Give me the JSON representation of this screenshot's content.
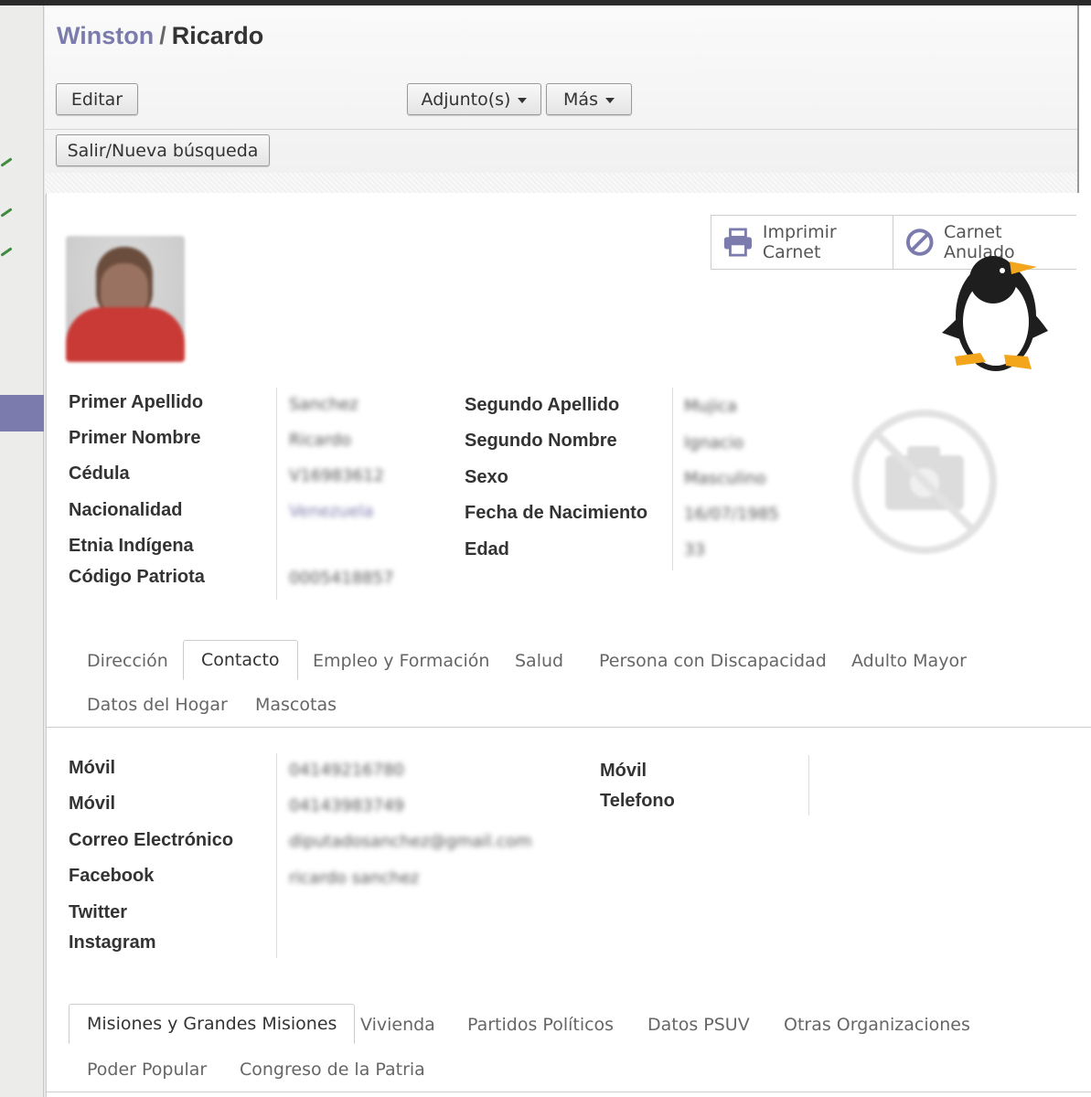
{
  "breadcrumb": {
    "parent": "Winston",
    "separator": "/",
    "current": "Ricardo"
  },
  "toolbar": {
    "edit_label": "Editar",
    "attachments_label": "Adjunto(s)",
    "more_label": "Más",
    "exit_search_label": "Salir/Nueva búsqueda"
  },
  "smart_buttons": {
    "print_label": "Imprimir Carnet",
    "cancelled_label": "Carnet Anulado"
  },
  "personal": {
    "left_labels": [
      "Primer Apellido",
      "Primer Nombre",
      "Cédula",
      "Nacionalidad",
      "Etnia Indígena",
      "Código Patriota"
    ],
    "left_values": [
      "Sanchez",
      "Ricardo",
      "V16983612",
      "Venezuela",
      "",
      "0005418857"
    ],
    "right_labels": [
      "Segundo Apellido",
      "Segundo Nombre",
      "Sexo",
      "Fecha de Nacimiento",
      "Edad"
    ],
    "right_values": [
      "Mujica",
      "Ignacio",
      "Masculino",
      "16/07/1985",
      "33"
    ]
  },
  "tabs_1": [
    "Dirección",
    "Contacto",
    "Empleo y Formación",
    "Salud",
    "Persona con Discapacidad",
    "Adulto Mayor",
    "Datos del Hogar",
    "Mascotas"
  ],
  "contact": {
    "left_labels": [
      "Móvil",
      "Móvil",
      "Correo Electrónico",
      "Facebook",
      "Twitter",
      "Instagram"
    ],
    "left_values": [
      "04149216780",
      "04143983749",
      "diputadosanchez@gmail.com",
      "ricardo sanchez",
      "",
      ""
    ],
    "right_labels": [
      "Móvil",
      "Telefono"
    ]
  },
  "tabs_2": [
    "Misiones y Grandes Misiones",
    "Vivienda",
    "Partidos Políticos",
    "Datos PSUV",
    "Otras Organizaciones",
    "Poder Popular",
    "Congreso de la Patria"
  ],
  "colors": {
    "brand": "#7c7bad",
    "text": "#333333"
  },
  "icons": [
    "printer-icon",
    "ban-icon",
    "no-image-icon",
    "penguin-icon"
  ]
}
